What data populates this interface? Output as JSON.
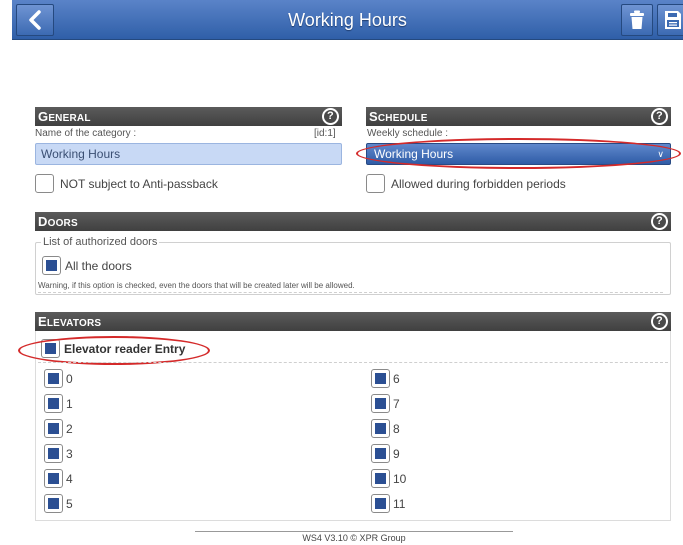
{
  "header": {
    "title": "Working Hours"
  },
  "general": {
    "heading_big": "G",
    "heading_rest": "ENERAL",
    "name_label": "Name of the category :",
    "id_label": "[id:1]",
    "name_value": "Working Hours",
    "anti_passback_label": "NOT subject to Anti-passback",
    "anti_passback_checked": false
  },
  "schedule": {
    "heading_big": "S",
    "heading_rest": "CHEDULE",
    "weekly_label": "Weekly schedule :",
    "weekly_value": "Working Hours",
    "forbidden_label": "Allowed during forbidden periods",
    "forbidden_checked": false
  },
  "doors": {
    "heading_big": "D",
    "heading_rest": "OORS",
    "legend": "List of authorized doors",
    "all_doors_label": "All the doors",
    "all_doors_checked": true,
    "warning": "Warning, if this option is checked, even the doors that will be created later will be allowed."
  },
  "elevators": {
    "heading_big": "E",
    "heading_rest": "LEVATORS",
    "reader_label": "Elevator reader Entry",
    "reader_checked": true,
    "floors_left": [
      "0",
      "1",
      "2",
      "3",
      "4",
      "5"
    ],
    "floors_right": [
      "6",
      "7",
      "8",
      "9",
      "10",
      "11"
    ]
  },
  "help_glyph": "?",
  "footer": {
    "text": "WS4 V3.10 © XPR Group"
  },
  "colors": {
    "accent": "#2f5fa8",
    "section_header": "#4a4a4a",
    "highlight": "#d42a2a"
  },
  "icons": {
    "back": "chevron-left-icon",
    "delete": "trash-icon",
    "save": "save-icon",
    "help": "help-icon"
  }
}
